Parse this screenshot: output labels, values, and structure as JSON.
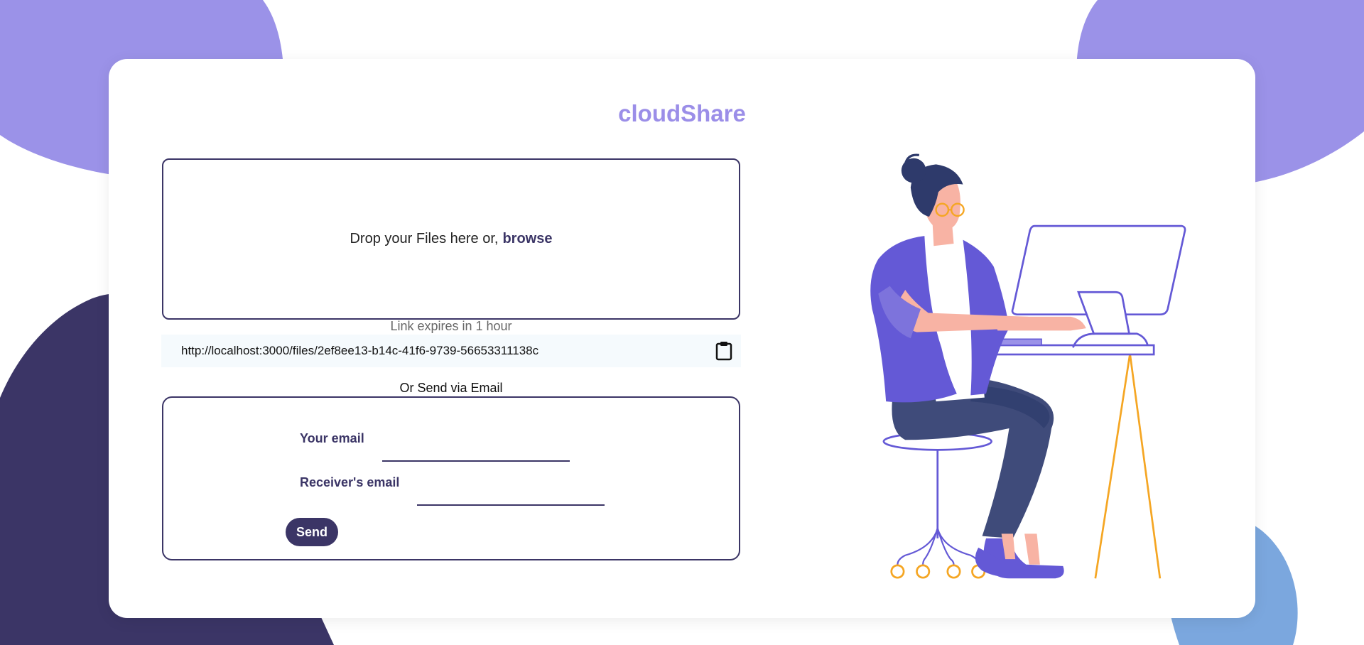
{
  "app": {
    "title": "cloudShare"
  },
  "upload": {
    "drop_text": "Drop your Files here or,",
    "browse_label": "browse"
  },
  "link": {
    "expires_text": "Link expires in 1 hour",
    "url": "http://localhost:3000/files/2ef8ee13-b14c-41f6-9739-56653311138c",
    "copy_icon": "clipboard-icon"
  },
  "email": {
    "heading": "Or Send via Email",
    "sender_label": "Your email",
    "sender_value": "",
    "receiver_label": "Receiver's email",
    "receiver_value": "",
    "send_label": "Send"
  },
  "colors": {
    "brand": "#9b8ee8",
    "primary_dark": "#3b3566",
    "blob_purple": "#9b92e8",
    "blob_navy": "#3b3566",
    "blob_blue": "#7ba7de",
    "accent_orange": "#f5a623"
  }
}
